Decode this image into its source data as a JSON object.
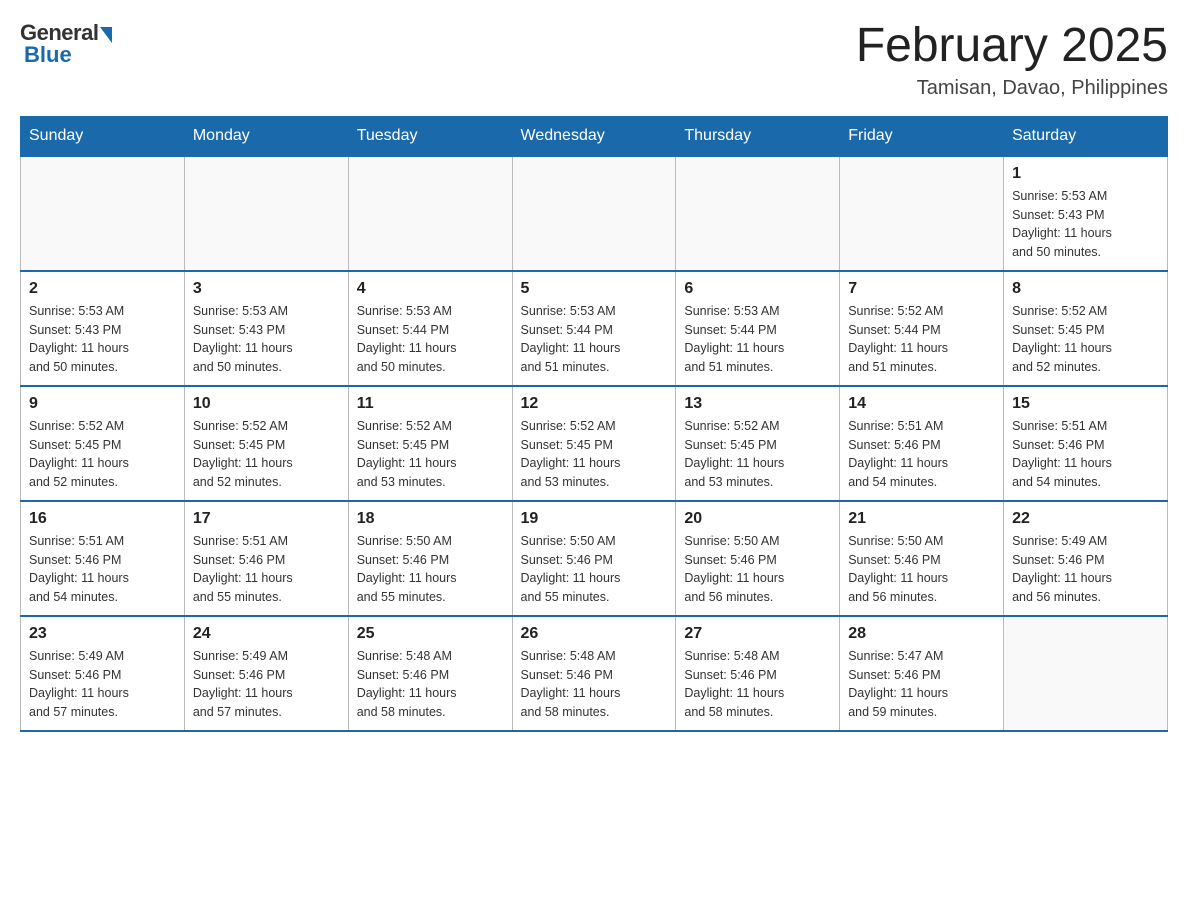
{
  "logo": {
    "general": "General",
    "blue": "Blue"
  },
  "title": {
    "month": "February 2025",
    "location": "Tamisan, Davao, Philippines"
  },
  "days_header": [
    "Sunday",
    "Monday",
    "Tuesday",
    "Wednesday",
    "Thursday",
    "Friday",
    "Saturday"
  ],
  "weeks": [
    {
      "days": [
        {
          "num": "",
          "info": ""
        },
        {
          "num": "",
          "info": ""
        },
        {
          "num": "",
          "info": ""
        },
        {
          "num": "",
          "info": ""
        },
        {
          "num": "",
          "info": ""
        },
        {
          "num": "",
          "info": ""
        },
        {
          "num": "1",
          "info": "Sunrise: 5:53 AM\nSunset: 5:43 PM\nDaylight: 11 hours\nand 50 minutes."
        }
      ]
    },
    {
      "days": [
        {
          "num": "2",
          "info": "Sunrise: 5:53 AM\nSunset: 5:43 PM\nDaylight: 11 hours\nand 50 minutes."
        },
        {
          "num": "3",
          "info": "Sunrise: 5:53 AM\nSunset: 5:43 PM\nDaylight: 11 hours\nand 50 minutes."
        },
        {
          "num": "4",
          "info": "Sunrise: 5:53 AM\nSunset: 5:44 PM\nDaylight: 11 hours\nand 50 minutes."
        },
        {
          "num": "5",
          "info": "Sunrise: 5:53 AM\nSunset: 5:44 PM\nDaylight: 11 hours\nand 51 minutes."
        },
        {
          "num": "6",
          "info": "Sunrise: 5:53 AM\nSunset: 5:44 PM\nDaylight: 11 hours\nand 51 minutes."
        },
        {
          "num": "7",
          "info": "Sunrise: 5:52 AM\nSunset: 5:44 PM\nDaylight: 11 hours\nand 51 minutes."
        },
        {
          "num": "8",
          "info": "Sunrise: 5:52 AM\nSunset: 5:45 PM\nDaylight: 11 hours\nand 52 minutes."
        }
      ]
    },
    {
      "days": [
        {
          "num": "9",
          "info": "Sunrise: 5:52 AM\nSunset: 5:45 PM\nDaylight: 11 hours\nand 52 minutes."
        },
        {
          "num": "10",
          "info": "Sunrise: 5:52 AM\nSunset: 5:45 PM\nDaylight: 11 hours\nand 52 minutes."
        },
        {
          "num": "11",
          "info": "Sunrise: 5:52 AM\nSunset: 5:45 PM\nDaylight: 11 hours\nand 53 minutes."
        },
        {
          "num": "12",
          "info": "Sunrise: 5:52 AM\nSunset: 5:45 PM\nDaylight: 11 hours\nand 53 minutes."
        },
        {
          "num": "13",
          "info": "Sunrise: 5:52 AM\nSunset: 5:45 PM\nDaylight: 11 hours\nand 53 minutes."
        },
        {
          "num": "14",
          "info": "Sunrise: 5:51 AM\nSunset: 5:46 PM\nDaylight: 11 hours\nand 54 minutes."
        },
        {
          "num": "15",
          "info": "Sunrise: 5:51 AM\nSunset: 5:46 PM\nDaylight: 11 hours\nand 54 minutes."
        }
      ]
    },
    {
      "days": [
        {
          "num": "16",
          "info": "Sunrise: 5:51 AM\nSunset: 5:46 PM\nDaylight: 11 hours\nand 54 minutes."
        },
        {
          "num": "17",
          "info": "Sunrise: 5:51 AM\nSunset: 5:46 PM\nDaylight: 11 hours\nand 55 minutes."
        },
        {
          "num": "18",
          "info": "Sunrise: 5:50 AM\nSunset: 5:46 PM\nDaylight: 11 hours\nand 55 minutes."
        },
        {
          "num": "19",
          "info": "Sunrise: 5:50 AM\nSunset: 5:46 PM\nDaylight: 11 hours\nand 55 minutes."
        },
        {
          "num": "20",
          "info": "Sunrise: 5:50 AM\nSunset: 5:46 PM\nDaylight: 11 hours\nand 56 minutes."
        },
        {
          "num": "21",
          "info": "Sunrise: 5:50 AM\nSunset: 5:46 PM\nDaylight: 11 hours\nand 56 minutes."
        },
        {
          "num": "22",
          "info": "Sunrise: 5:49 AM\nSunset: 5:46 PM\nDaylight: 11 hours\nand 56 minutes."
        }
      ]
    },
    {
      "days": [
        {
          "num": "23",
          "info": "Sunrise: 5:49 AM\nSunset: 5:46 PM\nDaylight: 11 hours\nand 57 minutes."
        },
        {
          "num": "24",
          "info": "Sunrise: 5:49 AM\nSunset: 5:46 PM\nDaylight: 11 hours\nand 57 minutes."
        },
        {
          "num": "25",
          "info": "Sunrise: 5:48 AM\nSunset: 5:46 PM\nDaylight: 11 hours\nand 58 minutes."
        },
        {
          "num": "26",
          "info": "Sunrise: 5:48 AM\nSunset: 5:46 PM\nDaylight: 11 hours\nand 58 minutes."
        },
        {
          "num": "27",
          "info": "Sunrise: 5:48 AM\nSunset: 5:46 PM\nDaylight: 11 hours\nand 58 minutes."
        },
        {
          "num": "28",
          "info": "Sunrise: 5:47 AM\nSunset: 5:46 PM\nDaylight: 11 hours\nand 59 minutes."
        },
        {
          "num": "",
          "info": ""
        }
      ]
    }
  ]
}
